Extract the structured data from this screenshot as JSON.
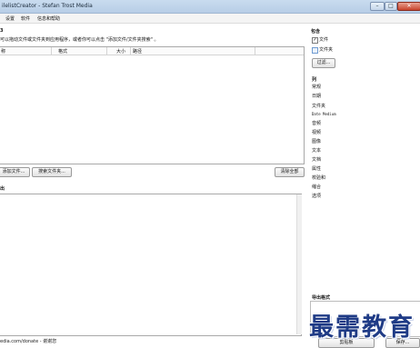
{
  "window": {
    "title": "ilelistCreator - Stefan Trost Media",
    "min": "–",
    "max": "□",
    "close": "✕"
  },
  "menu": [
    "设置",
    "软件",
    "信息和帮助"
  ],
  "left": {
    "corner_label": "3",
    "hint": "可以拖动文件或文件夹到应用程序，或者你可以点击 \"添加文件/文件夹搜索\" 。",
    "columns": [
      "称",
      "格式",
      "大小",
      "路径"
    ],
    "add_files_btn": "添加文件...",
    "search_folder_btn": "搜索文件夹...",
    "clear_all_btn": "清除全部",
    "output_label": "出",
    "status": "edia.com/donate - 谢谢您"
  },
  "right": {
    "include_title": "包含",
    "include_files": "文件",
    "include_folders": "文件夹",
    "filter_btn": "过滤...",
    "columns_title": "列",
    "column_items": [
      "常规",
      "日期",
      "文件夹",
      "Date Medium",
      "音频",
      "视频",
      "图像",
      "文本",
      "文档",
      "属性",
      "校验和",
      "缩合",
      "选项"
    ],
    "export_title": "导出格式",
    "clipboard_btn": "剪贴板",
    "save_btn": "保存..."
  },
  "watermark": "最需教育"
}
